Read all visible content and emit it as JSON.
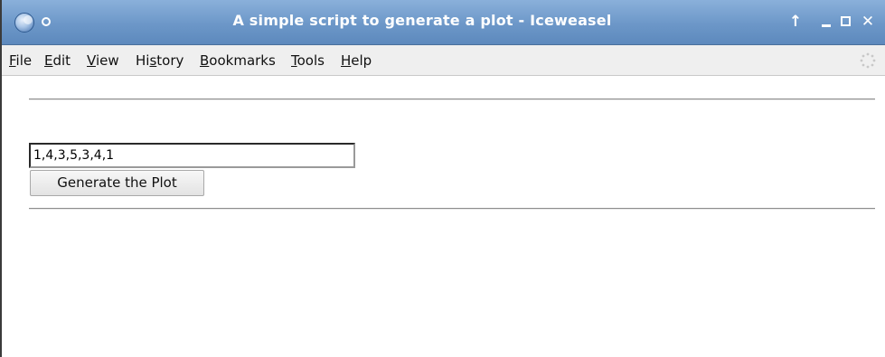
{
  "window": {
    "title": "A simple script to generate a plot - Iceweasel",
    "app_icon": "iceweasel-globe-icon",
    "controls": {
      "up": "↑",
      "minimize": "minimize-icon",
      "maximize": "maximize-icon",
      "close": "✕"
    }
  },
  "menubar": {
    "items": [
      {
        "mnemonic": "F",
        "rest": "ile"
      },
      {
        "mnemonic": "E",
        "rest": "dit"
      },
      {
        "mnemonic": "V",
        "rest": "iew"
      },
      {
        "pre": "Hi",
        "mnemonic": "s",
        "rest": "tory"
      },
      {
        "mnemonic": "B",
        "rest": "ookmarks"
      },
      {
        "mnemonic": "T",
        "rest": "ools"
      },
      {
        "mnemonic": "H",
        "rest": "elp"
      }
    ]
  },
  "form": {
    "data_input_value": "1,4,3,5,3,4,1",
    "button_label": "Generate the Plot"
  },
  "colors": {
    "titlebar": "#6c97c8",
    "menubar": "#efefef"
  }
}
